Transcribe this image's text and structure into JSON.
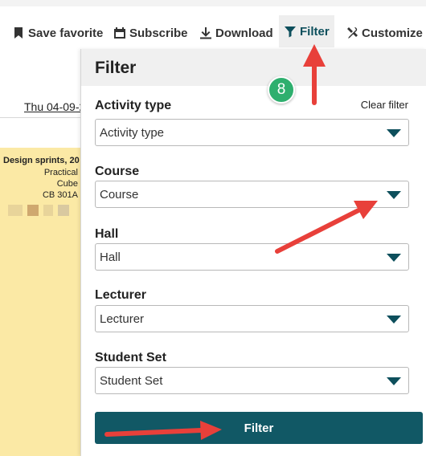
{
  "toolbar": {
    "save_favorite": "Save favorite",
    "subscribe": "Subscribe",
    "download": "Download",
    "filter": "Filter",
    "customize": "Customize"
  },
  "calendar": {
    "date": "Thu 04-09-2",
    "event": {
      "line1": "Design sprints, 20",
      "line2": "Practical",
      "line3": "Cube",
      "line4": "CB 301A"
    }
  },
  "filter_panel": {
    "title": "Filter",
    "clear_filter": "Clear filter",
    "fields": [
      {
        "label": "Activity type",
        "value": "Activity type"
      },
      {
        "label": "Course",
        "value": "Course"
      },
      {
        "label": "Hall",
        "value": "Hall"
      },
      {
        "label": "Lecturer",
        "value": "Lecturer"
      },
      {
        "label": "Student Set",
        "value": "Student Set"
      }
    ],
    "apply_button": "Filter"
  },
  "annotation": {
    "step_number": "8"
  },
  "colors": {
    "accent": "#115865",
    "event_bg": "#fbe9a5",
    "arrow": "#e8403a",
    "badge": "#2eaf6e"
  },
  "icons": [
    "bookmark-icon",
    "calendar-icon",
    "download-icon",
    "funnel-icon",
    "tools-icon",
    "chevron-down-icon"
  ]
}
